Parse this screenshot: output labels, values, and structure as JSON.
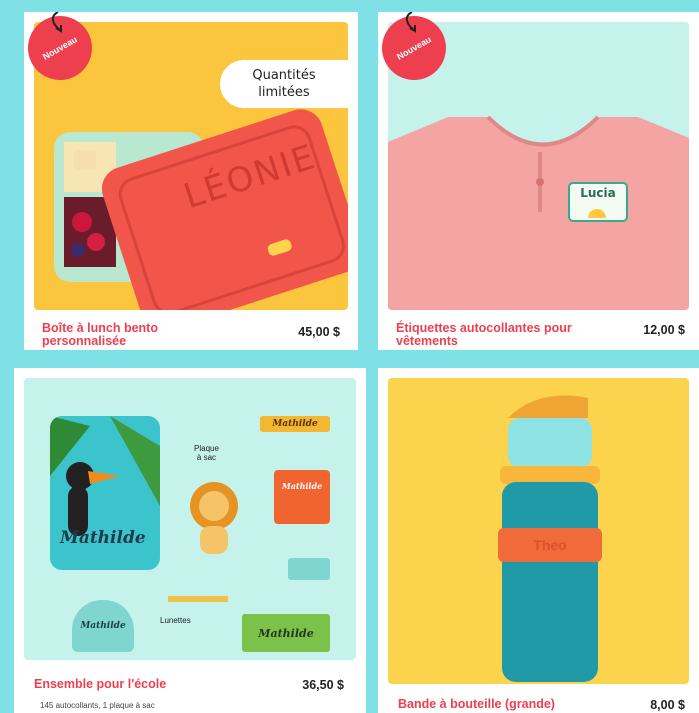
{
  "products": [
    {
      "badge": "Nouveau",
      "bubble": "Quantités\nlimitées",
      "lid_name": "LÉONIE",
      "title": "Boîte à lunch bento personnalisée",
      "price": "45,00 $"
    },
    {
      "badge": "Nouveau",
      "label_name": "Lucia",
      "title": "Étiquettes autocollantes pour vêtements",
      "price": "12,00 $"
    },
    {
      "tag_name": "Mathilde",
      "plaque_label": "Plaque\nà sac",
      "lunettes_label": "Lunettes",
      "title": "Ensemble pour l'école",
      "price": "36,50 $",
      "subtitle": "145 autocollants, 1 plaque à sac"
    },
    {
      "band_text": "Theo",
      "title": "Bande à bouteille (grande)",
      "price": "8,00 $"
    }
  ],
  "colors": {
    "accent": "#ee3f4f",
    "background": "#7fe0e6",
    "yellow": "#fcd34d",
    "mint": "#c6f2ec"
  }
}
